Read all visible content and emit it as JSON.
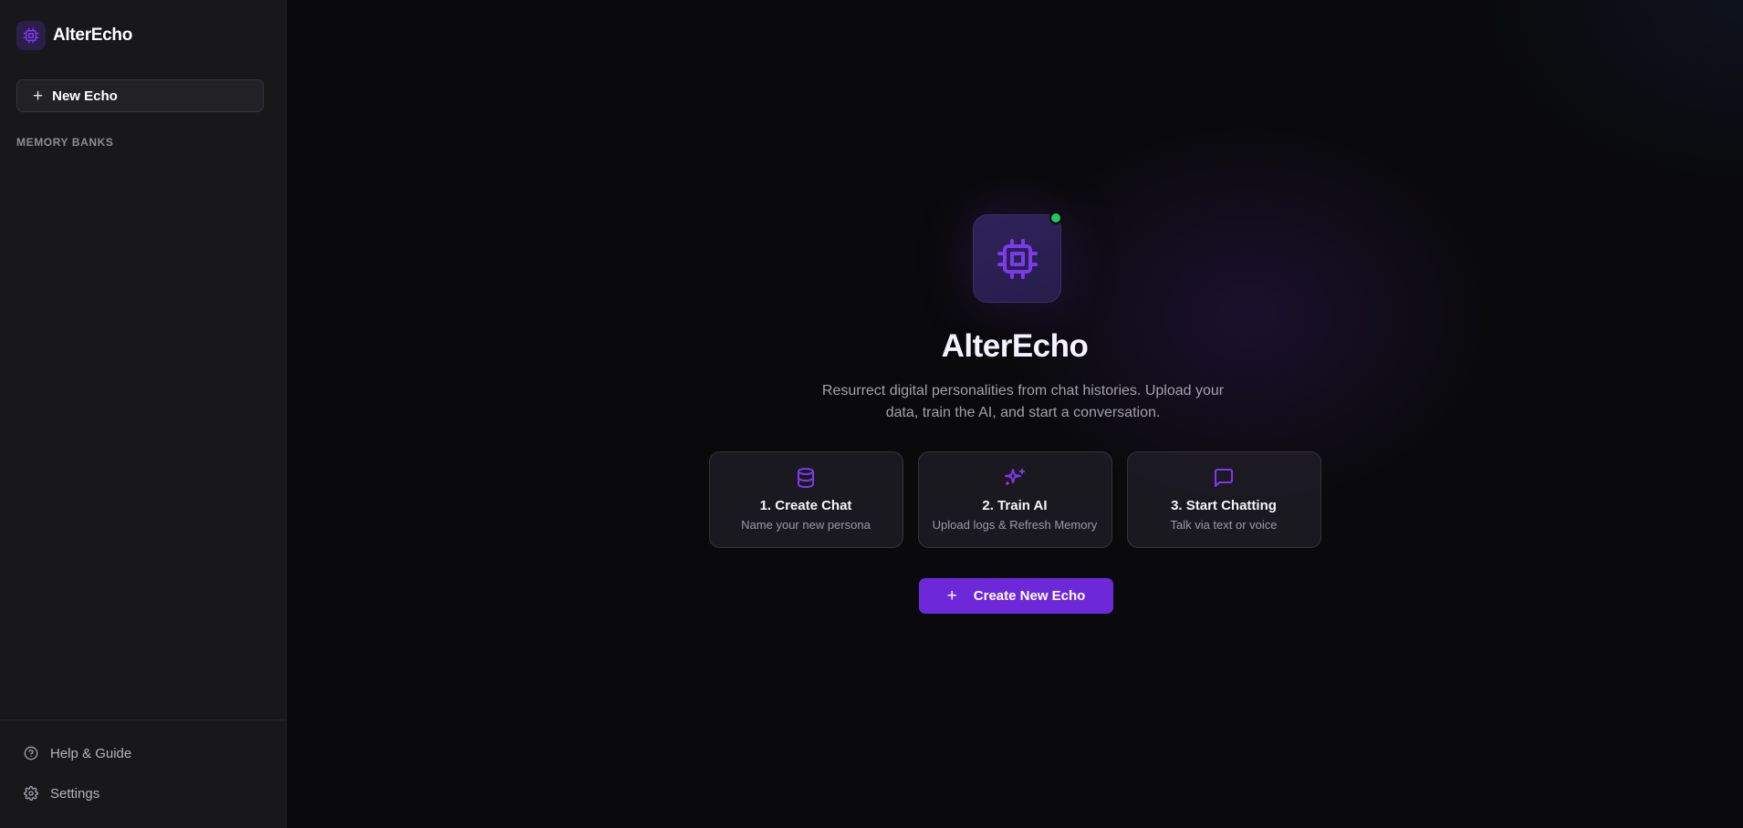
{
  "app": {
    "name": "AlterEcho"
  },
  "sidebar": {
    "new_button_label": "New Echo",
    "section_title": "MEMORY BANKS",
    "footer": {
      "help_label": "Help & Guide",
      "settings_label": "Settings"
    }
  },
  "hero": {
    "title": "AlterEcho",
    "subtitle": "Resurrect digital personalities from chat histories. Upload your data, train the AI, and start a conversation.",
    "status": "online"
  },
  "steps": [
    {
      "icon": "database-icon",
      "title": "1. Create Chat",
      "desc": "Name your new persona"
    },
    {
      "icon": "sparkles-icon",
      "title": "2. Train AI",
      "desc": "Upload logs & Refresh Memory"
    },
    {
      "icon": "message-square-icon",
      "title": "3. Start Chatting",
      "desc": "Talk via text or voice"
    }
  ],
  "cta": {
    "label": "Create New Echo"
  },
  "colors": {
    "accent": "#6d28d9",
    "accent_icon": "#7c3aed",
    "status_online": "#22c55e",
    "sidebar_bg": "#18181b",
    "main_bg": "#0a0a0c"
  }
}
